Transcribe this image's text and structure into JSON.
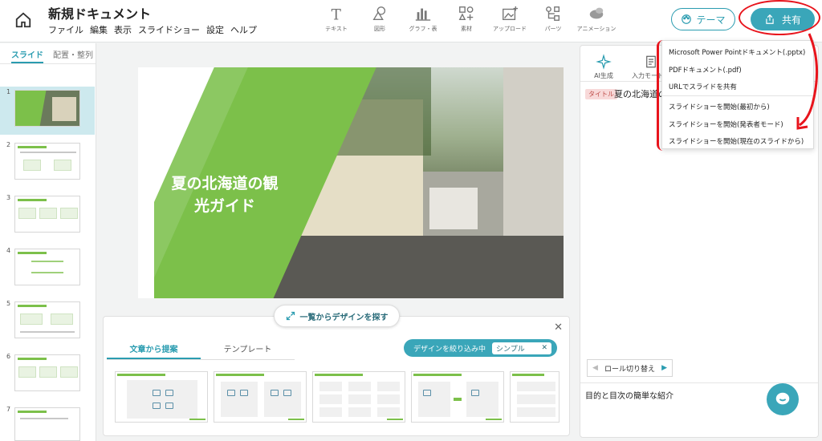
{
  "header": {
    "doc_title": "新規ドキュメント",
    "menu": [
      "ファイル",
      "編集",
      "表示",
      "スライドショー",
      "設定",
      "ヘルプ"
    ],
    "tools": [
      {
        "label": "テキスト",
        "icon": "text-icon"
      },
      {
        "label": "図形",
        "icon": "shapes-icon"
      },
      {
        "label": "グラフ・表",
        "icon": "chart-icon"
      },
      {
        "label": "素材",
        "icon": "assets-icon"
      },
      {
        "label": "アップロード",
        "icon": "upload-icon"
      },
      {
        "label": "パーツ",
        "icon": "parts-icon"
      },
      {
        "label": "アニメーション",
        "icon": "animation-icon"
      }
    ],
    "theme_label": "テーマ",
    "share_label": "共有"
  },
  "sidebar": {
    "tabs": [
      "スライド",
      "配置・整列"
    ],
    "slides": [
      "1",
      "2",
      "3",
      "4",
      "5",
      "6",
      "7"
    ]
  },
  "slide": {
    "title": "夏の北海道の観光ガイド",
    "title_line1": "夏の北海道の観",
    "title_line2": "光ガイド"
  },
  "find_design_label": "一覧からデザインを探す",
  "bottom_panel": {
    "tabs": [
      "文章から提案",
      "テンプレート"
    ],
    "filter_label": "デザインを絞り込み中",
    "filter_tag": "シンプル"
  },
  "right_panel": {
    "ai_label": "AI生成",
    "input_mode_label": "入力モード切",
    "title_tag": "タイトル",
    "title_text": "夏の北海道の",
    "role_switch_label": "ロール切り替え",
    "content_text": "目的と目次の簡単な紹介"
  },
  "share_menu": {
    "items": [
      "Microsoft Power Pointドキュメント(.pptx)",
      "PDFドキュメント(.pdf)",
      "URLでスライドを共有",
      "スライドショーを開始(最初から)",
      "スライドショーを開始(発表者モード)",
      "スライドショーを開始(現在のスライドから)"
    ]
  },
  "colors": {
    "accent": "#3aa6b9",
    "slide_green": "#7cc04a",
    "annotation_red": "#e8141c"
  }
}
